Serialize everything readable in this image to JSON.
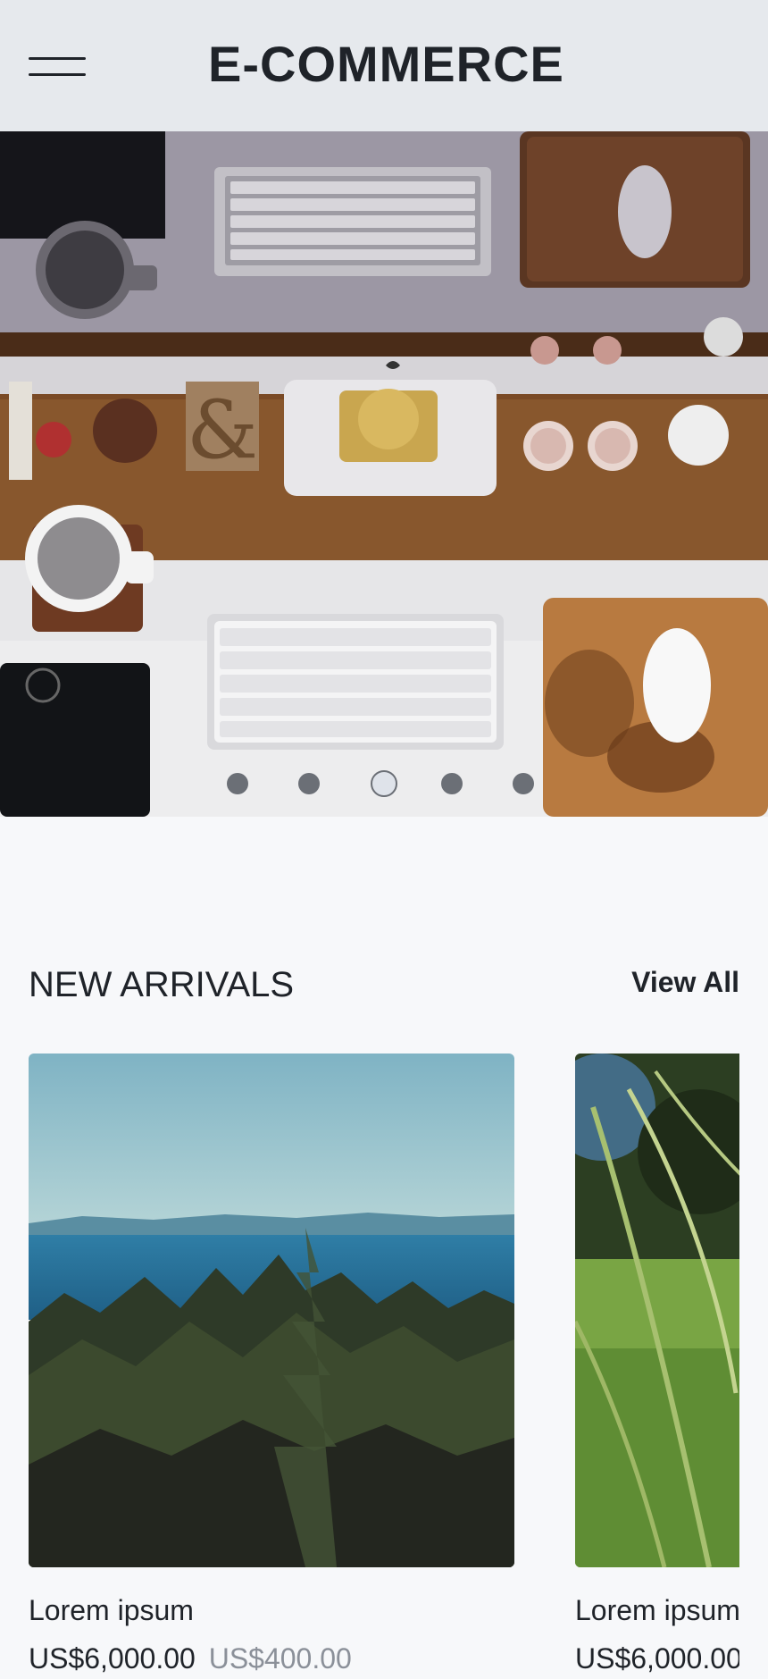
{
  "header": {
    "brand": "E-COMMERCE",
    "menu_icon": "hamburger-menu-icon"
  },
  "carousel": {
    "slide_count": 5,
    "active_index": 2,
    "image": "desk-workspace-photo"
  },
  "new_arrivals": {
    "title": "NEW ARRIVALS",
    "view_all_label": "View All",
    "products": [
      {
        "name": "Lorem ipsum",
        "price": "US$6,000.00",
        "old_price": "US$400.00",
        "image": "lake-forest-photo"
      },
      {
        "name": "Lorem ipsum",
        "price": "US$6,000.00",
        "old_price": "",
        "image": "grass-field-photo"
      }
    ]
  },
  "colors": {
    "header_bg": "#e6e9ed",
    "page_bg": "#f7f8fa",
    "text": "#1f2329",
    "muted_text": "#8b9099",
    "dot": "#6b6f76"
  }
}
